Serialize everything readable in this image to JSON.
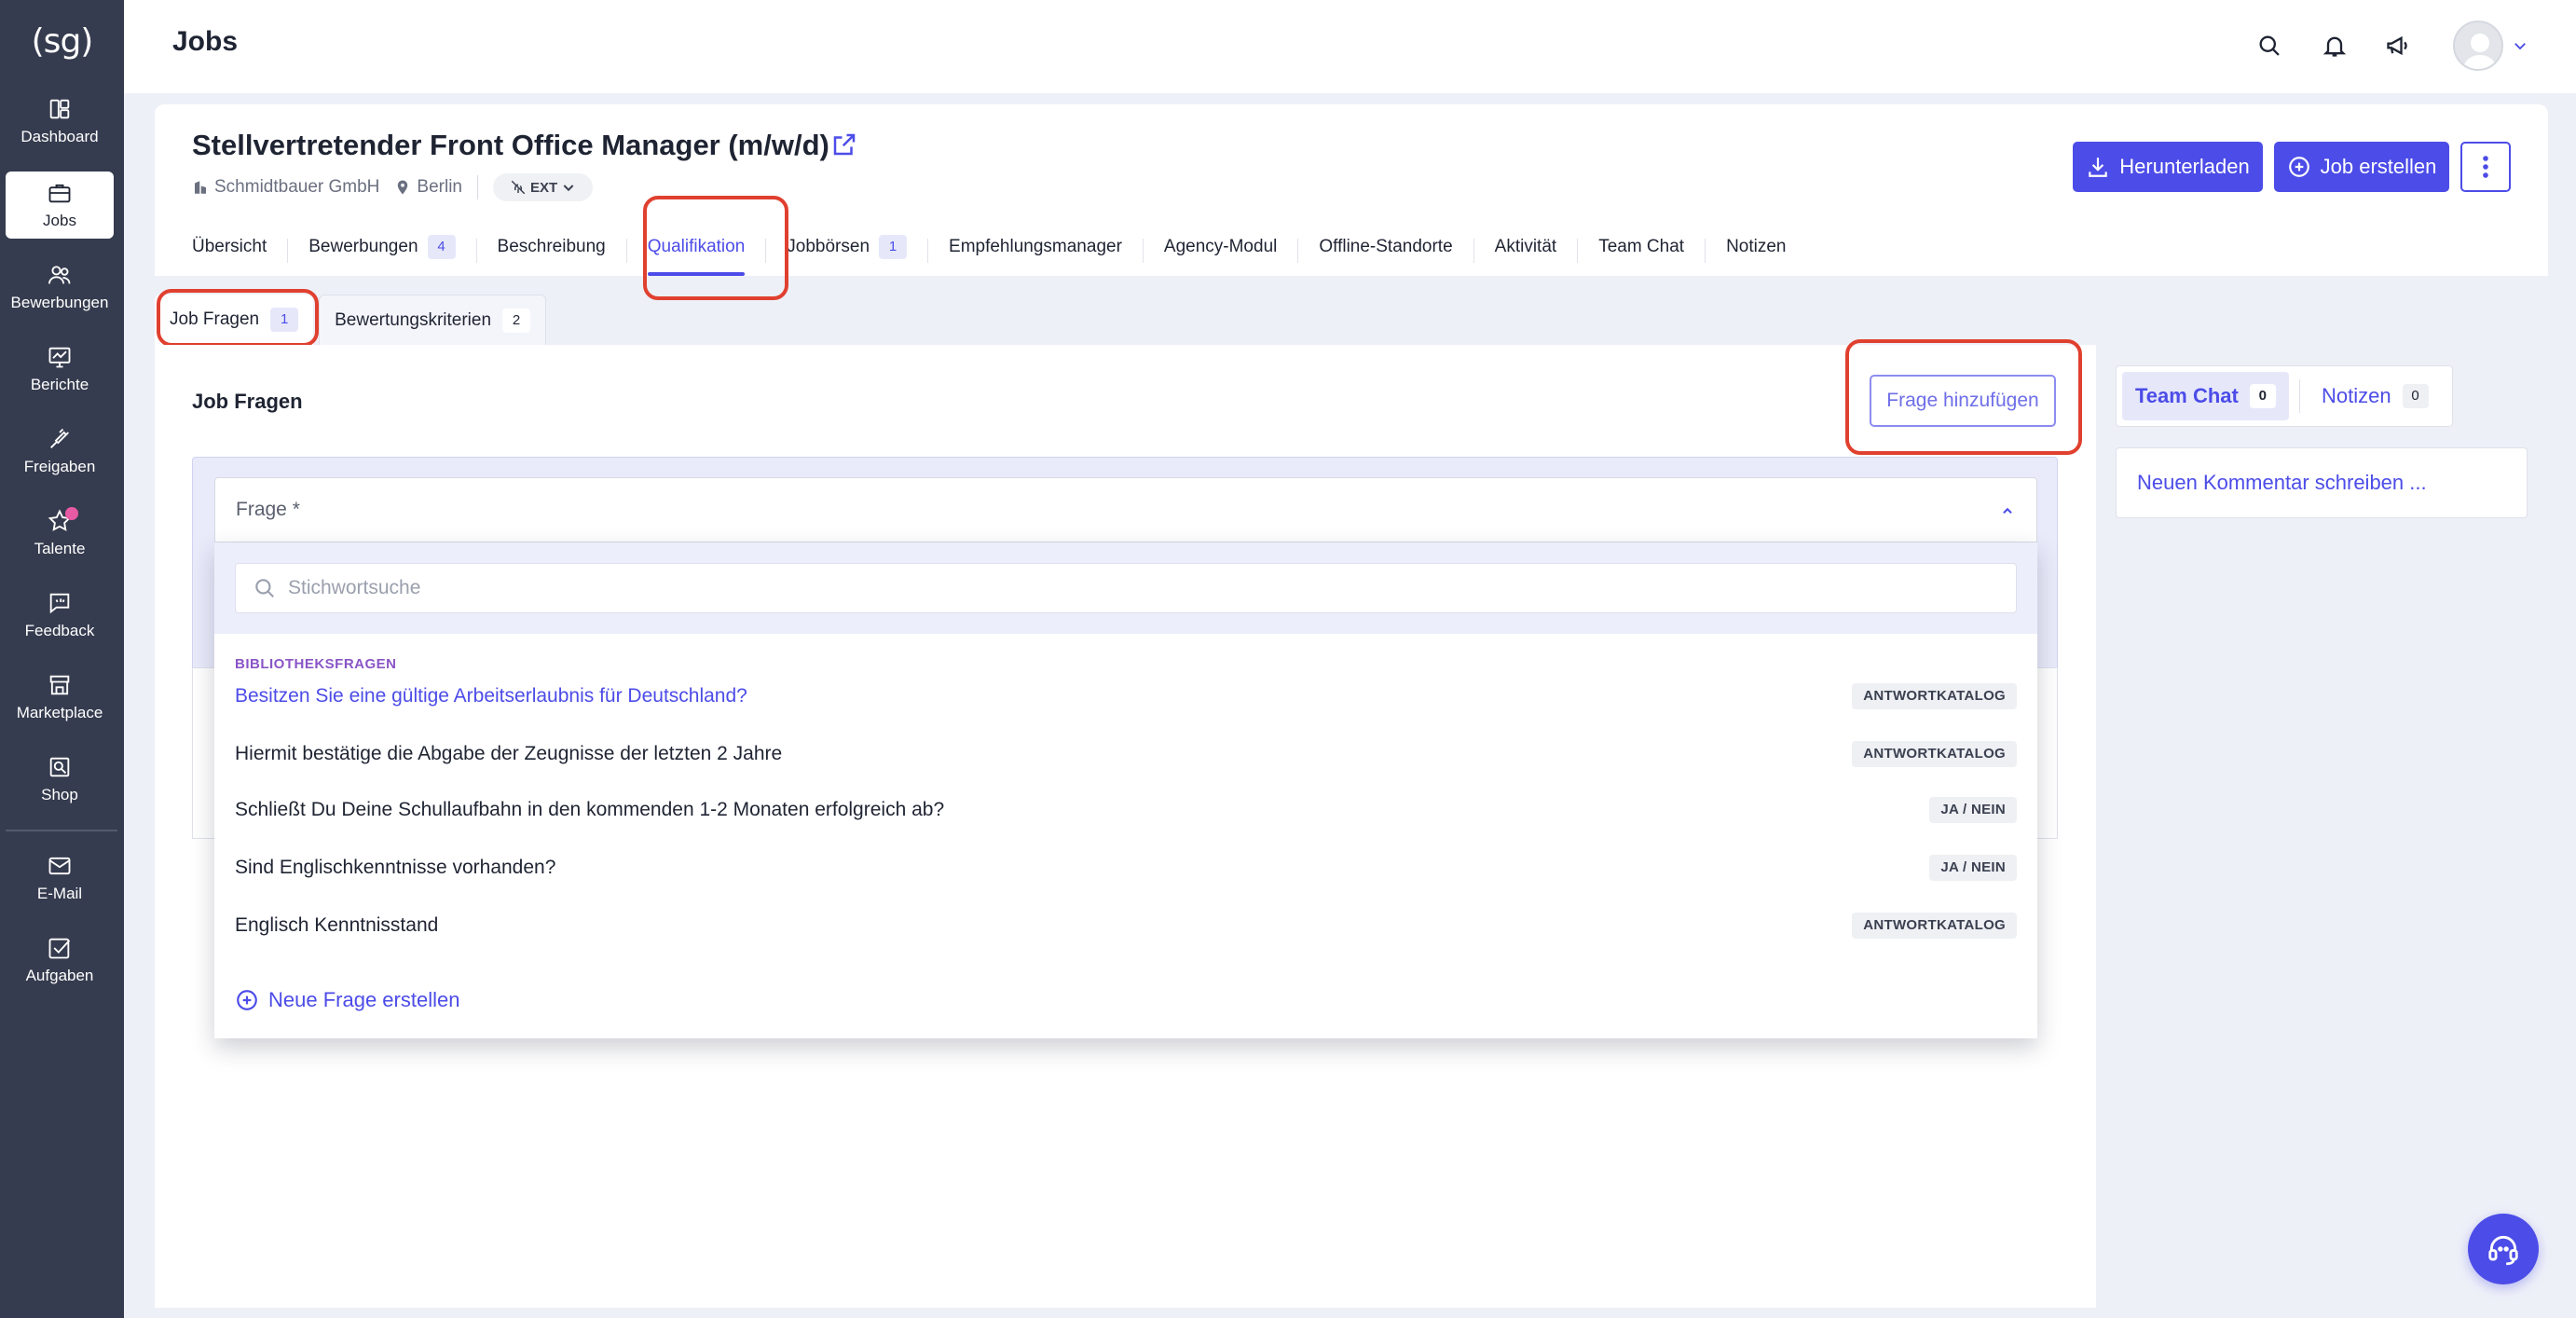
{
  "logo": {
    "text": "(sg)"
  },
  "sidebar": {
    "items": [
      {
        "label": "Dashboard",
        "icon": "dashboard-icon"
      },
      {
        "label": "Jobs",
        "icon": "briefcase-icon",
        "active": true
      },
      {
        "label": "Bewerbungen",
        "icon": "users-icon"
      },
      {
        "label": "Berichte",
        "icon": "chart-icon"
      },
      {
        "label": "Freigaben",
        "icon": "thumbs-up-icon"
      },
      {
        "label": "Talente",
        "icon": "star-icon"
      },
      {
        "label": "Feedback",
        "icon": "feedback-icon"
      },
      {
        "label": "Marketplace",
        "icon": "store-icon"
      },
      {
        "label": "Shop",
        "icon": "shop-icon"
      },
      {
        "label": "E-Mail",
        "icon": "mail-icon"
      },
      {
        "label": "Aufgaben",
        "icon": "tasks-icon"
      }
    ]
  },
  "topbar": {
    "title": "Jobs"
  },
  "job": {
    "title": "Stellvertretender Front Office Manager (m/w/d)",
    "company": "Schmidtbauer GmbH",
    "location": "Berlin",
    "visibility": "EXT"
  },
  "actions": {
    "download": "Herunterladen",
    "create": "Job erstellen"
  },
  "tabs": [
    {
      "label": "Übersicht"
    },
    {
      "label": "Bewerbungen",
      "count": "4"
    },
    {
      "label": "Beschreibung"
    },
    {
      "label": "Qualifikation",
      "active": true
    },
    {
      "label": "Jobbörsen",
      "count": "1"
    },
    {
      "label": "Empfehlungsmanager"
    },
    {
      "label": "Agency-Modul"
    },
    {
      "label": "Offline-Standorte"
    },
    {
      "label": "Aktivität"
    },
    {
      "label": "Team Chat"
    },
    {
      "label": "Notizen"
    }
  ],
  "subtabs": [
    {
      "label": "Job Fragen",
      "count": "1"
    },
    {
      "label": "Bewertungskriterien",
      "count": "2"
    }
  ],
  "section": {
    "title": "Job Fragen",
    "add_button": "Frage hinzufügen"
  },
  "form": {
    "select_label": "Frage *"
  },
  "dropdown": {
    "search_placeholder": "Stichwortsuche",
    "group_label": "BIBLIOTHEKSFRAGEN",
    "items": [
      {
        "text": "Besitzen Sie eine gültige Arbeitserlaubnis für Deutschland?",
        "tag": "ANTWORTKATALOG"
      },
      {
        "text": "Hiermit bestätige die Abgabe der Zeugnisse der letzten 2 Jahre",
        "tag": "ANTWORTKATALOG"
      },
      {
        "text": "Schließt Du Deine Schullaufbahn in den kommenden 1-2 Monaten erfolgreich ab?",
        "tag": "JA / NEIN"
      },
      {
        "text": "Sind Englischkenntnisse vorhanden?",
        "tag": "JA / NEIN"
      },
      {
        "text": "Englisch Kenntnisstand",
        "tag": "ANTWORTKATALOG"
      }
    ],
    "new_question": "Neue Frage erstellen"
  },
  "side": {
    "tabs": [
      {
        "label": "Team Chat",
        "count": "0"
      },
      {
        "label": "Notizen",
        "count": "0"
      }
    ],
    "comment_placeholder": "Neuen Kommentar schreiben ..."
  },
  "colors": {
    "accent": "#4c4ce8",
    "sidebar": "#363c4f",
    "highlight": "#e0402f",
    "group_label": "#8a55c6"
  }
}
